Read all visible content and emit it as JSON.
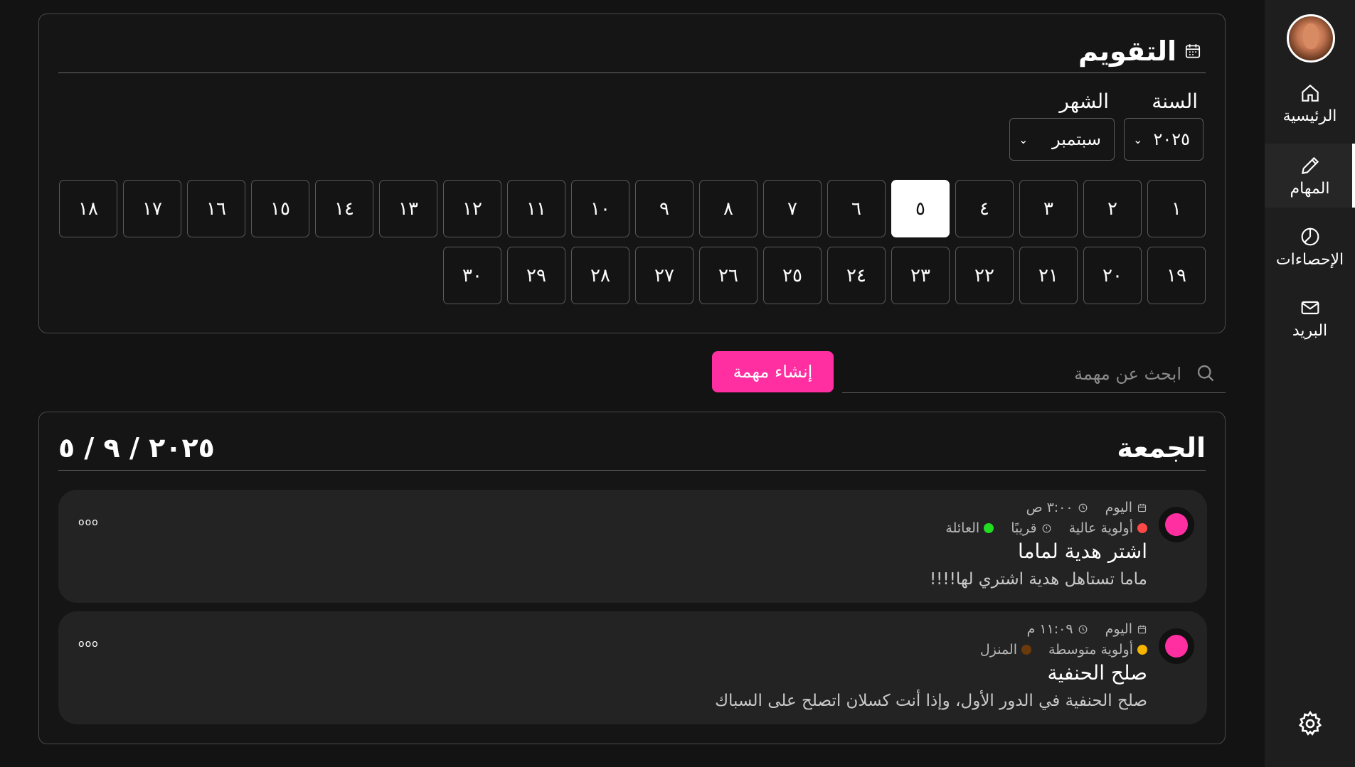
{
  "sidebar": {
    "items": [
      {
        "label": "الرئيسية",
        "icon": "home-icon"
      },
      {
        "label": "المهام",
        "icon": "pencil-icon",
        "active": true
      },
      {
        "label": "الإحصاءات",
        "icon": "pie-chart-icon"
      },
      {
        "label": "البريد",
        "icon": "mail-icon"
      }
    ],
    "settings_icon": "gear-icon"
  },
  "calendar": {
    "title": "التقويم",
    "year_label": "السنة",
    "year_value": "٢٠٢٥",
    "month_label": "الشهر",
    "month_value": "سبتمبر",
    "selected_day": "٥",
    "days": [
      "١",
      "٢",
      "٣",
      "٤",
      "٥",
      "٦",
      "٧",
      "٨",
      "٩",
      "١٠",
      "١١",
      "١٢",
      "١٣",
      "١٤",
      "١٥",
      "١٦",
      "١٧",
      "١٨",
      "١٩",
      "٢٠",
      "٢١",
      "٢٢",
      "٢٣",
      "٢٤",
      "٢٥",
      "٢٦",
      "٢٧",
      "٢٨",
      "٢٩",
      "٣٠"
    ]
  },
  "toolbar": {
    "search_placeholder": "ابحث عن مهمة",
    "create_label": "إنشاء مهمة"
  },
  "day_view": {
    "weekday": "الجمعة",
    "date": "٢٠٢٥ / ٩ / ٥",
    "tasks": [
      {
        "date_text": "اليوم",
        "time_text": "٣:٠٠ ص",
        "priority_text": "أولوية عالية",
        "priority_color": "#ff4848",
        "status_text": "قريبًا",
        "category_text": "العائلة",
        "category_color": "#22dd22",
        "title": "اشتر هدية لماما",
        "description": "ماما تستاهل هدية اشتري لها!!!!",
        "more_label": "ooo",
        "color": "#ff2fa1"
      },
      {
        "date_text": "اليوم",
        "time_text": "١١:٠٩ م",
        "priority_text": "أولوية متوسطة",
        "priority_color": "#f5b400",
        "category_text": "المنزل",
        "category_color": "#6b3a0a",
        "title": "صلح الحنفية",
        "description": "صلح الحنفية في الدور الأول، وإذا أنت كسلان اتصلح على السباك",
        "more_label": "ooo",
        "color": "#ff2fa1"
      }
    ]
  }
}
